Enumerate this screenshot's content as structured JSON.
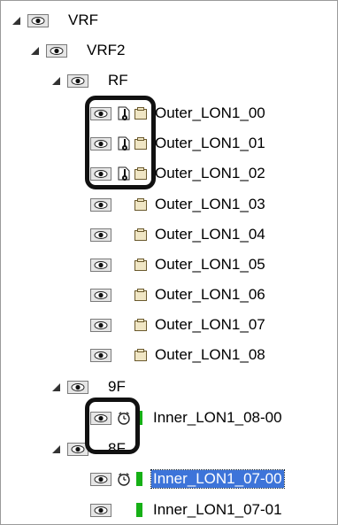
{
  "tree": {
    "vrf": {
      "label": "VRF"
    },
    "vrf2": {
      "label": "VRF2"
    },
    "rf": {
      "label": "RF"
    },
    "outer": [
      {
        "label": "Outer_LON1_00"
      },
      {
        "label": "Outer_LON1_01"
      },
      {
        "label": "Outer_LON1_02"
      },
      {
        "label": "Outer_LON1_03"
      },
      {
        "label": "Outer_LON1_04"
      },
      {
        "label": "Outer_LON1_05"
      },
      {
        "label": "Outer_LON1_06"
      },
      {
        "label": "Outer_LON1_07"
      },
      {
        "label": "Outer_LON1_08"
      }
    ],
    "f9": {
      "label": "9F"
    },
    "inner_9f": [
      {
        "label": "Inner_LON1_08-00"
      }
    ],
    "f8": {
      "label": "8F"
    },
    "inner_8f": [
      {
        "label": "Inner_LON1_07-00"
      },
      {
        "label": "Inner_LON1_07-01"
      }
    ]
  },
  "colors": {
    "selection": "#3d74d9",
    "status_green": "#16b016",
    "highlight_box": "#111111"
  },
  "icons": [
    "expand-triangle-icon",
    "eye-icon",
    "clock-icon",
    "document-icon",
    "folder-icon",
    "status-green-icon"
  ]
}
